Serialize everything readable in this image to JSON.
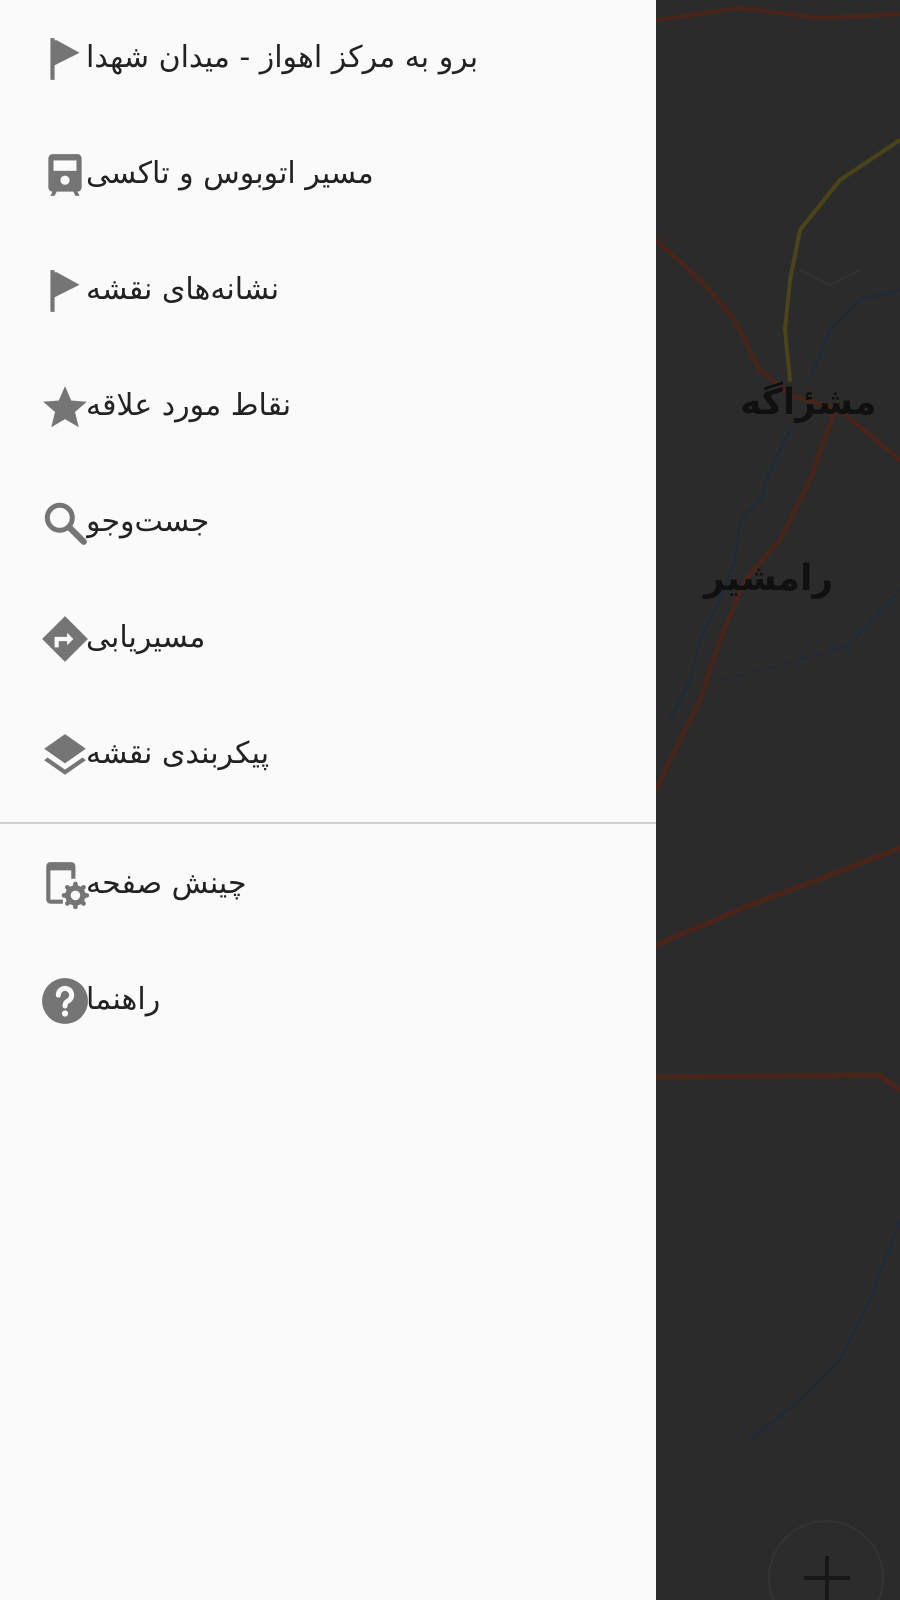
{
  "colors": {
    "drawer_background": "#fafafa",
    "icon": "#757575",
    "text": "#222222",
    "divider": "#cfcfcf",
    "map_overlay": "#2b2b2b"
  },
  "menu": {
    "items": [
      {
        "label": "برو به مرکز اهواز - میدان شهدا",
        "icon": "flag-icon"
      },
      {
        "label": "مسیر اتوبوس و تاکسی",
        "icon": "bus-icon"
      },
      {
        "label": "نشانه‌های نقشه",
        "icon": "flag-icon"
      },
      {
        "label": "نقاط مورد علاقه",
        "icon": "star-icon"
      },
      {
        "label": "جست‌وجو",
        "icon": "search-icon"
      },
      {
        "label": "مسیریابی",
        "icon": "directions-icon"
      },
      {
        "label": "پیکربندی نقشه",
        "icon": "layers-icon"
      }
    ],
    "secondary_items": [
      {
        "label": "چینش صفحه",
        "icon": "screen-settings-icon"
      },
      {
        "label": "راهنما",
        "icon": "help-icon"
      }
    ]
  },
  "map": {
    "labels": [
      "مشرٔاگه",
      "رامشیر"
    ],
    "zoom_in_icon": "plus-icon"
  }
}
